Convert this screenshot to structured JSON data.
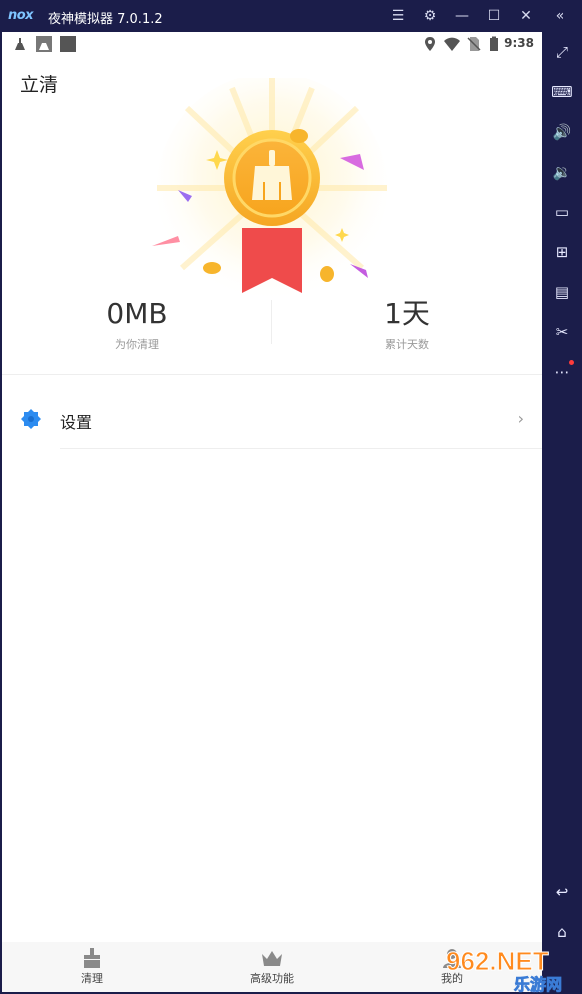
{
  "window": {
    "logo": "nox",
    "title": "夜神模拟器 7.0.1.2",
    "controls": [
      "menu-icon",
      "gear-icon",
      "minimize-icon",
      "maximize-icon",
      "close-icon",
      "collapse-icon"
    ]
  },
  "statusbar": {
    "time": "9:38",
    "icons": [
      "cleaner-notification-icon",
      "cleaner-notification-icon",
      "square-notification-icon",
      "location-icon",
      "wifi-icon",
      "no-sim-icon",
      "battery-icon"
    ]
  },
  "app": {
    "title": "立清",
    "stats": {
      "cleaned_value": "0MB",
      "cleaned_label": "为你清理",
      "days_value": "1天",
      "days_label": "累计天数"
    },
    "settings": {
      "label": "设置"
    },
    "nav": {
      "clean": "清理",
      "advanced": "高级功能",
      "mine": "我的"
    }
  },
  "toolbar": {
    "buttons": [
      "fullscreen-icon",
      "keyboard-icon",
      "volume-up-icon",
      "volume-down-icon",
      "screen-icon",
      "apk-install-icon",
      "multi-instance-icon",
      "scissors-icon",
      "more-icon",
      "back-icon",
      "home-icon"
    ]
  },
  "watermark": {
    "brand": "962.NET",
    "sub": "乐游网"
  },
  "colors": {
    "window_bg": "#1b1d4a",
    "medal_gold": "#f7b52c",
    "ribbon_red": "#ef4b4b",
    "settings_blue": "#2d8cf0"
  }
}
